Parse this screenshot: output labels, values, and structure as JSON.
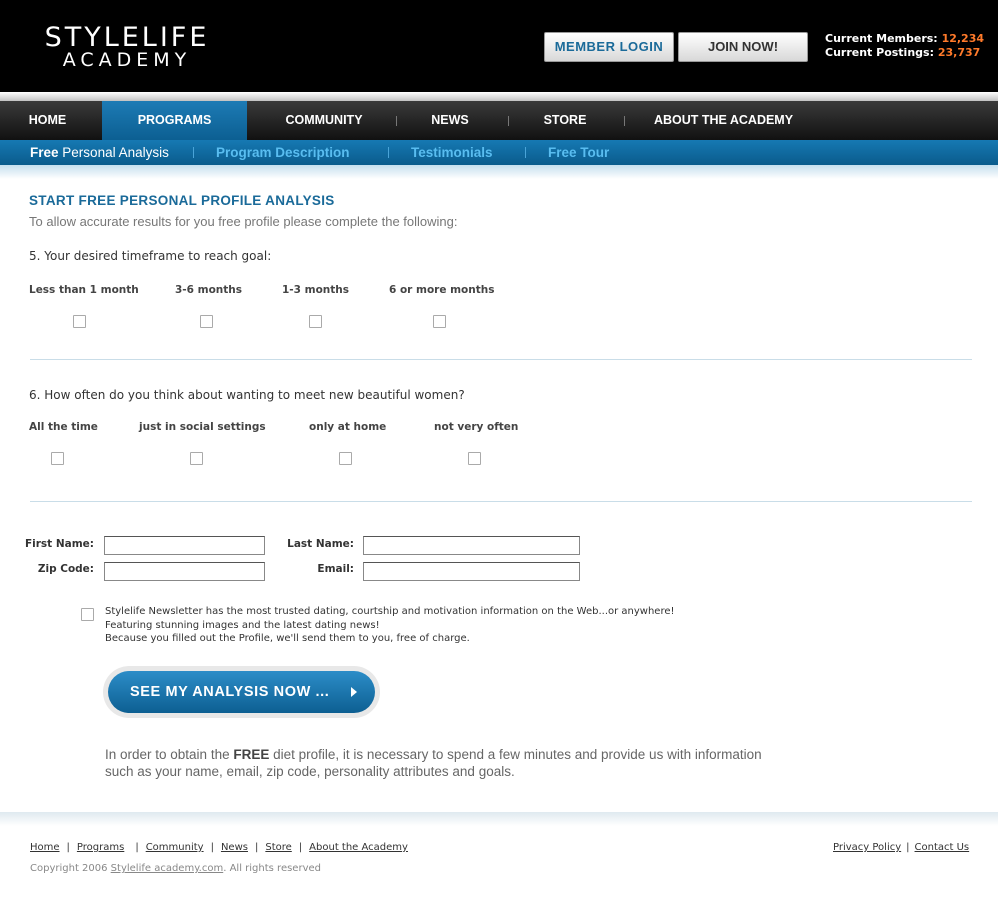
{
  "header": {
    "logo_line1": "STYLELIFE",
    "logo_line2": "ACADEMY",
    "login_label": "MEMBER LOGIN",
    "join_label": "JOIN NOW!",
    "members_label": "Current Members:",
    "members_count": "12,234",
    "postings_label": "Current Postings:",
    "postings_count": "23,737"
  },
  "nav": {
    "items": [
      {
        "label": "HOME"
      },
      {
        "label": "PROGRAMS",
        "active": true
      },
      {
        "label": "COMMUNITY"
      },
      {
        "label": "NEWS"
      },
      {
        "label": "STORE"
      },
      {
        "label": "ABOUT THE ACADEMY"
      }
    ]
  },
  "subnav": {
    "items": [
      {
        "bold": "Free",
        "thin": "Personal Analysis"
      },
      {
        "label": "Program Description"
      },
      {
        "label": "Testimonials"
      },
      {
        "label": "Free Tour"
      }
    ]
  },
  "content": {
    "title": "START FREE PERSONAL PROFILE ANALYSIS",
    "subtitle": "To allow accurate results for you free profile please complete the following:",
    "q5": {
      "question": "5. Your desired timeframe to reach goal:",
      "options": [
        "Less than 1 month",
        "3-6 months",
        "1-3 months",
        "6 or more months"
      ]
    },
    "q6": {
      "question": "6. How often do you think about wanting to meet new beautiful women?",
      "options": [
        "All the time",
        "just in social settings",
        "only at home",
        "not very often"
      ]
    }
  },
  "form": {
    "first_name_label": "First Name:",
    "last_name_label": "Last Name:",
    "zip_label": "Zip Code:",
    "email_label": "Email:",
    "first_name_value": "",
    "last_name_value": "",
    "zip_value": "",
    "email_value": ""
  },
  "newsletter": {
    "line1": "Stylelife Newsletter has the most trusted dating, courtship and motivation information on the Web...or anywhere!",
    "line2": "Featuring stunning images and the latest dating news!",
    "line3": "Because you filled out the Profile, we'll send them to you, free of charge."
  },
  "cta": {
    "label": "SEE MY ANALYSIS NOW ..."
  },
  "note": {
    "line1_pre": "In order to obtain the ",
    "line1_bold": "FREE",
    "line1_post": " diet profile, it is necessary to spend a few minutes and provide us with information",
    "line2": "such as your name, email, zip code, personality attributes and goals."
  },
  "footer": {
    "links": [
      "Home",
      "Programs",
      "Community",
      "News",
      "Store",
      "About the Academy"
    ],
    "right_links": [
      "Privacy Policy",
      "Contact Us"
    ],
    "copyright_pre": "Copyright 2006 ",
    "copyright_link": "Stylelife academy.com",
    "copyright_post": ".  All rights reserved"
  }
}
